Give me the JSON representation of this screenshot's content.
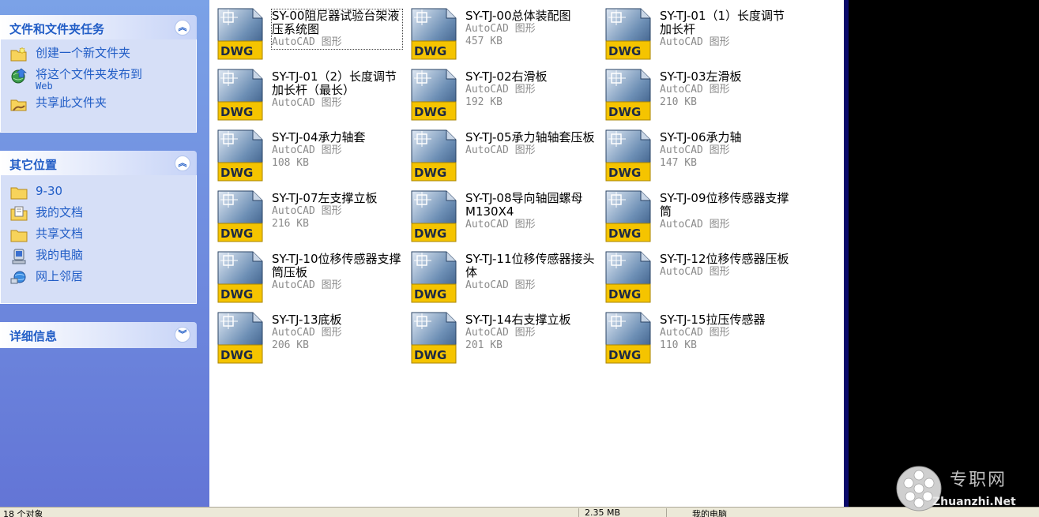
{
  "taskpane": {
    "groups": [
      {
        "title": "文件和文件夹任务",
        "collapse_icon": "double-chevron-up",
        "items": [
          {
            "label": "创建一个新文件夹",
            "icon": "new-folder-icon"
          },
          {
            "label": "将这个文件夹发布到",
            "sub": "Web",
            "icon": "publish-web-icon"
          },
          {
            "label": "共享此文件夹",
            "icon": "share-folder-icon"
          }
        ]
      },
      {
        "title": "其它位置",
        "collapse_icon": "double-chevron-up",
        "items": [
          {
            "label": "9-30",
            "icon": "folder-icon"
          },
          {
            "label": "我的文档",
            "icon": "my-documents-icon"
          },
          {
            "label": "共享文档",
            "icon": "folder-icon"
          },
          {
            "label": "我的电脑",
            "icon": "my-computer-icon"
          },
          {
            "label": "网上邻居",
            "icon": "network-places-icon"
          }
        ]
      },
      {
        "title": "详细信息",
        "collapse_icon": "double-chevron-down",
        "items": []
      }
    ]
  },
  "icon_badge": "DWG",
  "files": [
    {
      "name": "SY-00阻尼器试验台架液压系统图",
      "type": "AutoCAD 图形",
      "size": ""
    },
    {
      "name": "SY-TJ-00总体装配图",
      "type": "AutoCAD 图形",
      "size": "457 KB"
    },
    {
      "name": "SY-TJ-01（1）长度调节加长杆",
      "type": "AutoCAD 图形",
      "size": ""
    },
    {
      "name": "SY-TJ-01（2）长度调节加长杆（最长）",
      "type": "AutoCAD 图形",
      "size": ""
    },
    {
      "name": "SY-TJ-02右滑板",
      "type": "AutoCAD 图形",
      "size": "192 KB"
    },
    {
      "name": "SY-TJ-03左滑板",
      "type": "AutoCAD 图形",
      "size": "210 KB"
    },
    {
      "name": "SY-TJ-04承力轴套",
      "type": "AutoCAD 图形",
      "size": "108 KB"
    },
    {
      "name": "SY-TJ-05承力轴轴套压板",
      "type": "AutoCAD 图形",
      "size": ""
    },
    {
      "name": "SY-TJ-06承力轴",
      "type": "AutoCAD 图形",
      "size": "147 KB"
    },
    {
      "name": "SY-TJ-07左支撑立板",
      "type": "AutoCAD 图形",
      "size": "216 KB"
    },
    {
      "name": "SY-TJ-08导向轴园螺母M130X4",
      "type": "AutoCAD 图形",
      "size": ""
    },
    {
      "name": "SY-TJ-09位移传感器支撑筒",
      "type": "AutoCAD 图形",
      "size": ""
    },
    {
      "name": "SY-TJ-10位移传感器支撑筒压板",
      "type": "AutoCAD 图形",
      "size": ""
    },
    {
      "name": "SY-TJ-11位移传感器接头体",
      "type": "AutoCAD 图形",
      "size": ""
    },
    {
      "name": "SY-TJ-12位移传感器压板",
      "type": "AutoCAD 图形",
      "size": ""
    },
    {
      "name": "SY-TJ-13底板",
      "type": "AutoCAD 图形",
      "size": "206 KB"
    },
    {
      "name": "SY-TJ-14右支撑立板",
      "type": "AutoCAD 图形",
      "size": "201 KB"
    },
    {
      "name": "SY-TJ-15拉压传感器",
      "type": "AutoCAD 图形",
      "size": "110 KB"
    }
  ],
  "statusbar": {
    "left": "18 个对象",
    "middle": "2.35 MB",
    "right": "我的电脑"
  },
  "watermark": {
    "cn": "专职网",
    "en": "Zhuanzhi.Net"
  },
  "colors": {
    "taskpane_top": "#7ba2e7",
    "taskpane_bottom": "#6375d6",
    "link": "#215dc6",
    "badge": "#f5c400"
  }
}
